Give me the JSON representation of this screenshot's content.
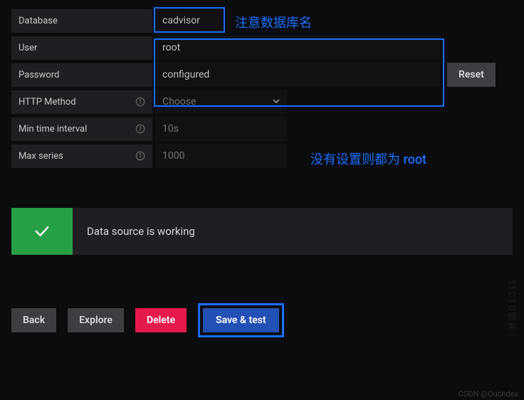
{
  "form": {
    "database": {
      "label": "Database",
      "value": "cadvisor"
    },
    "user": {
      "label": "User",
      "value": "root"
    },
    "password": {
      "label": "Password",
      "value": "configured",
      "reset_label": "Reset"
    },
    "http_method": {
      "label": "HTTP Method",
      "value": "Choose"
    },
    "min_time_interval": {
      "label": "Min time interval",
      "placeholder": "10s"
    },
    "max_series": {
      "label": "Max series",
      "placeholder": "1000"
    }
  },
  "annotations": {
    "db_note": "注意数据库名",
    "root_note": "没有设置则都为 root"
  },
  "status": {
    "message": "Data source is working"
  },
  "actions": {
    "back": "Back",
    "explore": "Explore",
    "delete": "Delete",
    "save": "Save & test"
  },
  "watermarks": {
    "side": "51CTO博客",
    "bottom": "CSDN @Ouchdex"
  }
}
